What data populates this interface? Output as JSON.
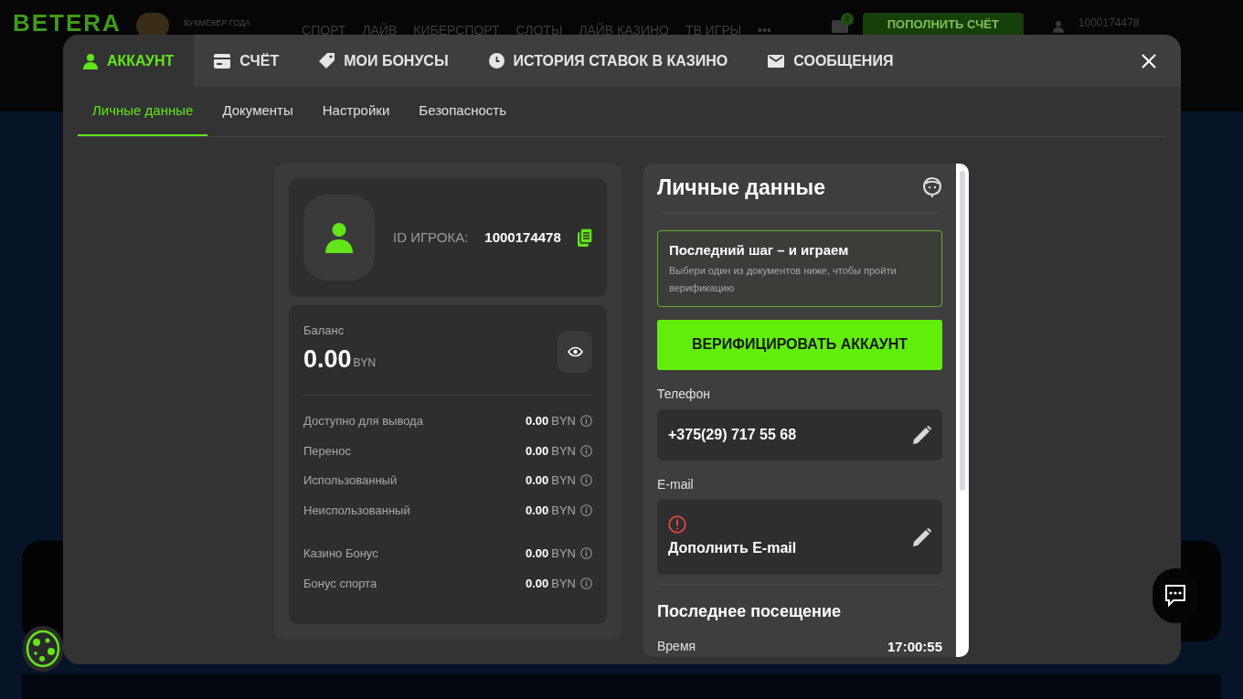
{
  "site_header": {
    "logo": "BETERA",
    "award": "БУКМЕКЕР ГОДА",
    "nav": [
      "СПОРТ",
      "ЛАЙВ",
      "КИБЕРСПОРТ",
      "СЛОТЫ",
      "ЛАЙВ КАЗИНО",
      "ТВ ИГРЫ",
      "•••"
    ],
    "mail_badge": "2",
    "deposit_button": "ПОПОЛНИТЬ СЧЁТ",
    "user_id": "1000174478"
  },
  "modal": {
    "tabs": [
      {
        "label": "АККАУНТ",
        "kind": "user",
        "selected": true
      },
      {
        "label": "СЧЁТ",
        "kind": "card",
        "selected": false
      },
      {
        "label": "МОИ БОНУСЫ",
        "kind": "tag",
        "selected": false
      },
      {
        "label": "ИСТОРИЯ СТАВОК В КАЗИНО",
        "kind": "clock",
        "selected": false
      },
      {
        "label": "СООБЩЕНИЯ",
        "kind": "mail",
        "selected": false
      }
    ],
    "subtabs": [
      {
        "label": "Личные данные",
        "selected": true
      },
      {
        "label": "Документы",
        "selected": false
      },
      {
        "label": "Настройки",
        "selected": false
      },
      {
        "label": "Безопасность",
        "selected": false
      }
    ],
    "profile": {
      "id_label": "ID ИГРОКА:",
      "id_value": "1000174478"
    },
    "balance": {
      "label": "Баланс",
      "amount": "0.00",
      "currency": "BYN",
      "groups": [
        [
          {
            "label": "Доступно для вывода",
            "amount": "0.00",
            "currency": "BYN"
          },
          {
            "label": "Перенос",
            "amount": "0.00",
            "currency": "BYN"
          },
          {
            "label": "Использованный",
            "amount": "0.00",
            "currency": "BYN"
          },
          {
            "label": "Неиспользованный",
            "amount": "0.00",
            "currency": "BYN"
          }
        ],
        [
          {
            "label": "Казино Бонус",
            "amount": "0.00",
            "currency": "BYN"
          },
          {
            "label": "Бонус спорта",
            "amount": "0.00",
            "currency": "BYN"
          }
        ]
      ]
    },
    "personal": {
      "title": "Личные данные",
      "notice": {
        "title": "Последний шаг – и играем",
        "text": "Выбери один из документов ниже, чтобы пройти верификацию"
      },
      "verify_button": "ВЕРИФИЦИРОВАТЬ АККАУНТ",
      "fields": [
        {
          "label": "Телефон",
          "value": "+375(29) 717 55 68",
          "warning": false
        },
        {
          "label": "E-mail",
          "value": "Дополнить E-mail",
          "warning": true
        }
      ],
      "last_visit": {
        "title": "Последнее посещение",
        "rows": [
          {
            "label": "Время",
            "value": "17:00:55"
          }
        ]
      }
    }
  }
}
